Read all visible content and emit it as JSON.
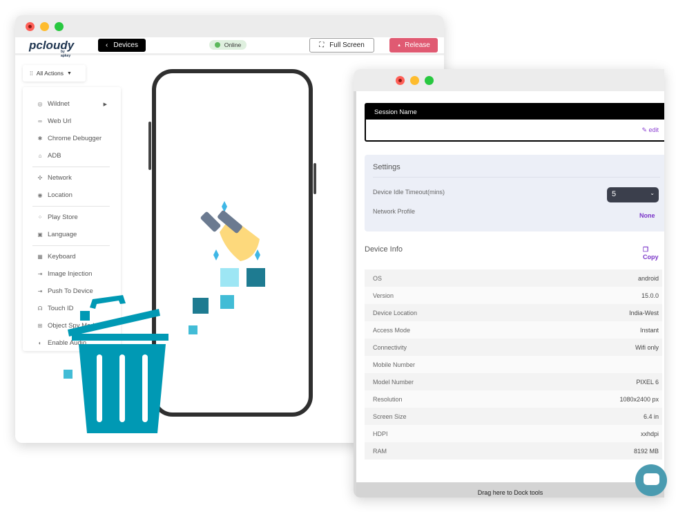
{
  "main_window": {
    "logo": "pcloudy",
    "logo_sub": "by apkey",
    "devices_label": "Devices",
    "status": "Online",
    "fullscreen_label": "Full Screen",
    "release_label": "Release",
    "all_actions_label": "All Actions",
    "menu": [
      {
        "label": "Wildnet",
        "icon": "wildnet-icon",
        "g": "◎"
      },
      {
        "label": "Web Url",
        "icon": "link-icon",
        "g": "∞"
      },
      {
        "label": "Chrome Debugger",
        "icon": "bug-icon",
        "g": "✱"
      },
      {
        "label": "ADB",
        "icon": "adb-icon",
        "g": "⌂"
      },
      {
        "label": "Network",
        "icon": "network-icon",
        "g": "✣"
      },
      {
        "label": "Location",
        "icon": "location-icon",
        "g": "◉"
      },
      {
        "label": "Play Store",
        "icon": "apps-icon",
        "g": "⁘"
      },
      {
        "label": "Language",
        "icon": "language-icon",
        "g": "▣"
      },
      {
        "label": "Keyboard",
        "icon": "keyboard-icon",
        "g": "▦"
      },
      {
        "label": "Image Injection",
        "icon": "inject-icon",
        "g": "⇥"
      },
      {
        "label": "Push To Device",
        "icon": "push-icon",
        "g": "⇥"
      },
      {
        "label": "Touch ID",
        "icon": "fingerprint-icon",
        "g": "☊"
      },
      {
        "label": "Object Spy Mode",
        "icon": "object-spy-icon",
        "g": "⊞"
      },
      {
        "label": "Enable Audio",
        "icon": "audio-icon",
        "g": "◐"
      }
    ]
  },
  "right_window": {
    "session_name_label": "Session Name",
    "edit_label": "edit",
    "settings_title": "Settings",
    "idle_timeout_label": "Device Idle Timeout(mins)",
    "idle_timeout_value": "5",
    "network_profile_label": "Network Profile",
    "network_profile_value": "None",
    "device_info_title": "Device Info",
    "copy_label": "Copy",
    "rows": [
      {
        "k": "OS",
        "v": "android"
      },
      {
        "k": "Version",
        "v": "15.0.0"
      },
      {
        "k": "Device Location",
        "v": "India-West"
      },
      {
        "k": "Access Mode",
        "v": "Instant"
      },
      {
        "k": "Connectivity",
        "v": "Wifi only"
      },
      {
        "k": "Mobile Number",
        "v": ""
      },
      {
        "k": "Model Number",
        "v": "PIXEL 6"
      },
      {
        "k": "Resolution",
        "v": "1080x2400 px"
      },
      {
        "k": "Screen Size",
        "v": "6.4 in"
      },
      {
        "k": "HDPI",
        "v": "xxhdpi"
      },
      {
        "k": "RAM",
        "v": "8192 MB"
      }
    ],
    "dock_label": "Drag here to Dock tools"
  },
  "colors": {
    "release": "#e05a72",
    "accent": "#7a35c8",
    "trash": "#0099b4",
    "chat": "#4a9bb0"
  }
}
